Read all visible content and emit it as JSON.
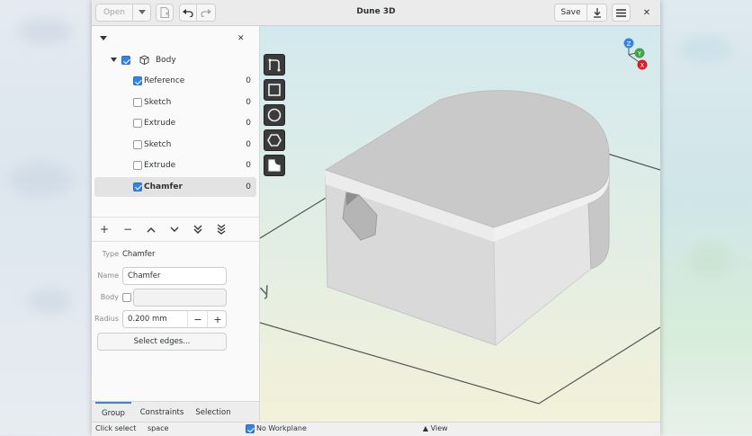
{
  "window": {
    "title": "Dune 3D"
  },
  "header": {
    "open_label": "Open",
    "open_menu_icon": "chevron-down-icon",
    "new_icon": "new-document-icon",
    "undo_icon": "undo-icon",
    "redo_icon": "redo-icon",
    "save_label": "Save",
    "export_icon": "download-icon",
    "menu_icon": "hamburger-menu-icon",
    "close_glyph": "✕"
  },
  "tree": {
    "root": {
      "label": "Body",
      "checked": true
    },
    "items": [
      {
        "label": "Reference",
        "count": "0",
        "checked": true,
        "selected": false,
        "bold": false
      },
      {
        "label": "Sketch",
        "count": "0",
        "checked": false,
        "selected": false,
        "bold": false
      },
      {
        "label": "Extrude",
        "count": "0",
        "checked": false,
        "selected": false,
        "bold": false
      },
      {
        "label": "Sketch",
        "count": "0",
        "checked": false,
        "selected": false,
        "bold": false
      },
      {
        "label": "Extrude",
        "count": "0",
        "checked": false,
        "selected": false,
        "bold": false
      },
      {
        "label": "Chamfer",
        "count": "0",
        "checked": true,
        "selected": true,
        "bold": true
      }
    ],
    "close_glyph": "✕"
  },
  "toolbar": {
    "add": "+",
    "remove": "−",
    "move_up": "⌃",
    "move_down": "⌄",
    "move_down_more": "≫",
    "move_bottom": "⤓"
  },
  "props": {
    "type_label": "Type",
    "type_value": "Chamfer",
    "name_label": "Name",
    "name_value": "Chamfer",
    "body_label": "Body",
    "body_value": "",
    "radius_label": "Radius",
    "radius_value": "0.200 mm",
    "minus": "−",
    "plus": "+",
    "select_edges_label": "Select edges..."
  },
  "tabs": [
    {
      "label": "Group",
      "active": true
    },
    {
      "label": "Constraints",
      "active": false
    },
    {
      "label": "Selection",
      "active": false
    }
  ],
  "status": {
    "action": "Click select",
    "key": "space",
    "workplane_label": "No Workplane",
    "workplane_checked": true,
    "view_label": "▲ View"
  },
  "viewport": {
    "axes": {
      "z": "Z",
      "y": "Y",
      "x": "X"
    },
    "axis_colors": {
      "z": "#3584e4",
      "y": "#3fa34d",
      "x": "#e01b24"
    },
    "tools": [
      "draw-path-icon",
      "rectangle-icon",
      "circle-icon",
      "hexagon-icon",
      "fillet-icon"
    ],
    "ground_label": "y"
  }
}
